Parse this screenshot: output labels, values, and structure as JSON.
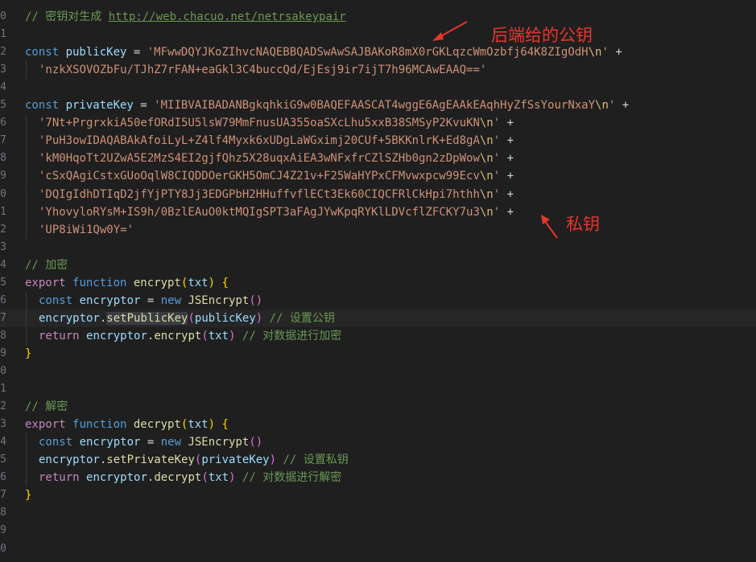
{
  "editor": {
    "language": "javascript",
    "line1_comment": "// 密钥对生成 ",
    "line1_link": "http://web.chacuo.net/netrsakeypair",
    "public_key_name": "publicKey",
    "public_key_parts": [
      "'MFwwDQYJKoZIhvcNAQEBBQADSwAwSAJBAKoR8mX0rGKLqzcWmOzbfj64K8ZIgOdH",
      "'nzkXSOVOZbFu/TJhZ7rFAN+eaGkl3C4buccQd/EjEsj9ir7ijT7h96MCAwEAAQ=='"
    ],
    "private_key_name": "privateKey",
    "private_key_parts": [
      "'MIIBVAIBADANBgkqhkiG9w0BAQEFAASCAT4wggE6AgEAAkEAqhHyZfSsYourNxaY",
      "'7Nt+PrgrxkiA50efORdI5U5lsW79MmFnusUA355oaSXcLhu5xxB38SMSyP2KvuKN",
      "'PuH3owIDAQABAkAfoiLyL+Z4lf4Myxk6xUDgLaWGximj20CUf+5BKKnlrK+Ed8gA",
      "'kM0HqoTt2UZwA5E2MzS4EI2gjfQhz5X28uqxAiEA3wNFxfrCZlSZHb0gn2zDpWow",
      "'cSxQAgiCstxGUoOqlW8CIQDDOerGKH5OmCJ4Z21v+F25WaHYPxCFMvwxpcw99Ecv",
      "'DQIgIdhDTIqD2jfYjPTY8Jj3EDGPbH2HHuffvflECt3Ek60CIQCFRlCkHpi7hthh",
      "'YhovyloRYsM+IS9h/0BzlEAuO0ktMQIgSPT3aFAgJYwKpqRYKlLDVcflZFCKY7u3",
      "'UP8iWi1Qw0Y='"
    ],
    "escape": "\\n",
    "encrypt_comment": "// 加密",
    "encrypt_fn": "encrypt",
    "decrypt_comment": "// 解密",
    "decrypt_fn": "decrypt",
    "set_public_comment": "// 设置公钥",
    "set_private_comment": "// 设置私钥",
    "encrypt_return_comment": "// 对数据进行加密",
    "decrypt_return_comment": "// 对数据进行解密",
    "line_numbers": [
      "0",
      "1",
      "2",
      "3",
      "4",
      "5",
      "6",
      "7",
      "8",
      "9",
      "0",
      "1",
      "2",
      "3",
      "4",
      "5",
      "6",
      "7",
      "8",
      "9",
      "0",
      "1",
      "2",
      "3",
      "4",
      "5",
      "6",
      "7",
      "8",
      "9",
      "0"
    ]
  },
  "annotations": {
    "public_key_label": "后端给的公钥",
    "private_key_label": "私钥",
    "color": "#e8352e"
  }
}
